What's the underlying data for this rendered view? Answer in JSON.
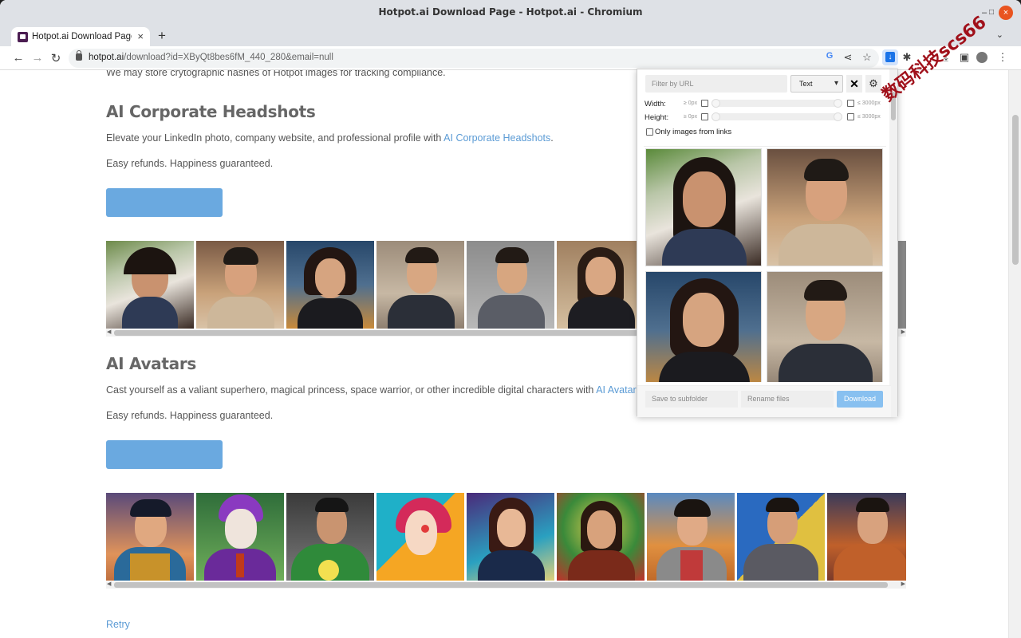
{
  "window": {
    "title": "Hotpot.ai Download Page - Hotpot.ai - Chromium",
    "minimize": "–",
    "maximize": "□",
    "close": "×"
  },
  "tab": {
    "label": "Hotpot.ai Download Page",
    "close": "×",
    "new_tab": "+",
    "tab_menu": "⌄"
  },
  "address": {
    "host": "hotpot.ai",
    "path": "/download?id=XByQt8bes6fM_440_280&email=null"
  },
  "page": {
    "intro_text": "We may store crytographic hashes of Hotpot images for tracking compliance.",
    "sections": [
      {
        "title": "AI Corporate Headshots",
        "desc_prefix": "Elevate your LinkedIn photo, company website, and professional profile with ",
        "desc_link": "AI Corporate Headshots",
        "desc_suffix": ".",
        "guarantee": "Easy refunds. Happiness guaranteed."
      },
      {
        "title": "AI Avatars",
        "desc_prefix": "Cast yourself as a valiant superhero, magical princess, space warrior, or other incredible digital characters with ",
        "desc_link": "AI Avatars",
        "desc_suffix": ".",
        "guarantee": "Easy refunds. Happiness guaranteed."
      }
    ],
    "retry_link": "Retry"
  },
  "popup": {
    "filter_placeholder": "Filter by URL",
    "type_select": "Text",
    "clear_symbol": "✕",
    "settings_symbol": "⚙",
    "width_label": "Width:",
    "height_label": "Height:",
    "min_label": "≥ 0px",
    "max_label": "≤ 3000px",
    "only_links_label": "Only images from links",
    "subfolder_placeholder": "Save to subfolder",
    "rename_placeholder": "Rename files",
    "download_label": "Download"
  },
  "watermark": "数码科技scs66",
  "colors": {
    "link": "#5b9bd5",
    "cta": "#6aa9e0",
    "download_button": "#88c0f0",
    "close_button": "#e95420"
  },
  "icons": [
    "back-arrow-icon",
    "forward-arrow-icon",
    "reload-icon",
    "lock-icon",
    "google-icon",
    "share-icon",
    "bookmark-star-icon",
    "image-downloader-extension-icon",
    "extensions-puzzle-icon",
    "downloads-icon",
    "side-panel-icon",
    "profile-icon",
    "kebab-menu-icon"
  ]
}
